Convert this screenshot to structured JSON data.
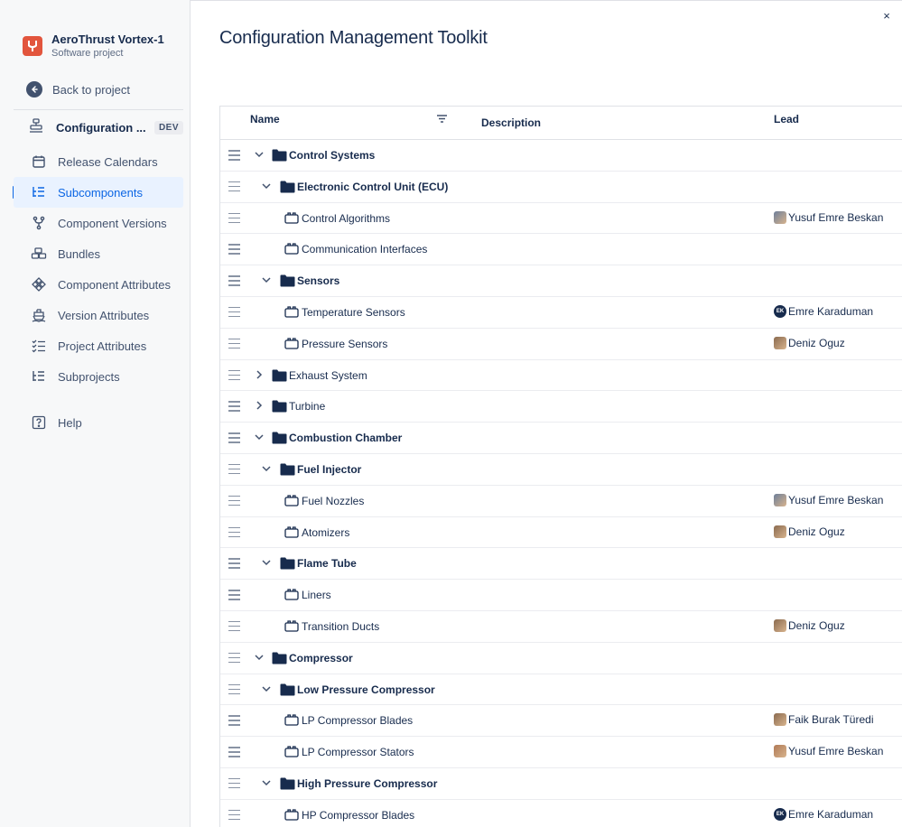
{
  "sidebar": {
    "project_name": "AeroThrust Vortex-1",
    "project_type": "Software project",
    "back_label": "Back to project",
    "context_label": "Configuration ...",
    "context_badge": "DEV",
    "items": [
      {
        "label": "Release Calendars",
        "icon": "calendar-icon"
      },
      {
        "label": "Subcomponents",
        "icon": "tree-list-icon",
        "active": true
      },
      {
        "label": "Component Versions",
        "icon": "branch-icon"
      },
      {
        "label": "Bundles",
        "icon": "boxes-icon"
      },
      {
        "label": "Component Attributes",
        "icon": "diamond-grid-icon"
      },
      {
        "label": "Version Attributes",
        "icon": "ship-icon"
      },
      {
        "label": "Project Attributes",
        "icon": "checklist-icon"
      },
      {
        "label": "Subprojects",
        "icon": "tree-list-icon"
      },
      {
        "label": "Help",
        "icon": "help-icon"
      }
    ]
  },
  "main": {
    "title": "Configuration Management Toolkit",
    "close_glyph": "×",
    "columns": {
      "name": "Name",
      "description": "Description",
      "lead": "Lead"
    },
    "rows": [
      {
        "name": "Control Systems",
        "level": 0,
        "type": "folder",
        "expanded": true,
        "lead": ""
      },
      {
        "name": "Electronic Control Unit (ECU)",
        "level": 1,
        "type": "folder",
        "expanded": true,
        "lead": ""
      },
      {
        "name": "Control Algorithms",
        "level": 2,
        "type": "component",
        "lead": "Yusuf Emre Beskan",
        "avatar": "photo"
      },
      {
        "name": "Communication Interfaces",
        "level": 2,
        "type": "component",
        "lead": ""
      },
      {
        "name": "Sensors",
        "level": 1,
        "type": "folder",
        "expanded": true,
        "lead": ""
      },
      {
        "name": "Temperature Sensors",
        "level": 2,
        "type": "component",
        "lead": "Emre Karaduman",
        "avatar": "initials",
        "initials": "EK"
      },
      {
        "name": "Pressure Sensors",
        "level": 2,
        "type": "component",
        "lead": "Deniz Oguz",
        "avatar": "photo"
      },
      {
        "name": "Exhaust System",
        "level": 0,
        "type": "folder",
        "expanded": false,
        "lead": ""
      },
      {
        "name": "Turbine",
        "level": 0,
        "type": "folder",
        "expanded": false,
        "lead": ""
      },
      {
        "name": "Combustion Chamber",
        "level": 0,
        "type": "folder",
        "expanded": true,
        "lead": ""
      },
      {
        "name": "Fuel Injector",
        "level": 1,
        "type": "folder",
        "expanded": true,
        "lead": ""
      },
      {
        "name": "Fuel Nozzles",
        "level": 2,
        "type": "component",
        "lead": "Yusuf Emre Beskan",
        "avatar": "photo"
      },
      {
        "name": "Atomizers",
        "level": 2,
        "type": "component",
        "lead": "Deniz Oguz",
        "avatar": "photo"
      },
      {
        "name": "Flame Tube",
        "level": 1,
        "type": "folder",
        "expanded": true,
        "lead": ""
      },
      {
        "name": "Liners",
        "level": 2,
        "type": "component",
        "lead": ""
      },
      {
        "name": "Transition Ducts",
        "level": 2,
        "type": "component",
        "lead": "Deniz Oguz",
        "avatar": "photo"
      },
      {
        "name": "Compressor",
        "level": 0,
        "type": "folder",
        "expanded": true,
        "lead": ""
      },
      {
        "name": "Low Pressure Compressor",
        "level": 1,
        "type": "folder",
        "expanded": true,
        "lead": ""
      },
      {
        "name": "LP Compressor Blades",
        "level": 2,
        "type": "component",
        "lead": "Faik Burak Türedi",
        "avatar": "photo"
      },
      {
        "name": "LP Compressor Stators",
        "level": 2,
        "type": "component",
        "lead": "Yusuf Emre Beskan",
        "avatar": "photo"
      },
      {
        "name": "High Pressure Compressor",
        "level": 1,
        "type": "folder",
        "expanded": true,
        "lead": ""
      },
      {
        "name": "HP Compressor Blades",
        "level": 2,
        "type": "component",
        "lead": "Emre Karaduman",
        "avatar": "initials",
        "initials": "EK"
      }
    ]
  },
  "colors": {
    "accent": "#0c66e4",
    "active_bg": "#e9f2ff",
    "logo": "#e2553d",
    "folder": "#172b4d"
  }
}
